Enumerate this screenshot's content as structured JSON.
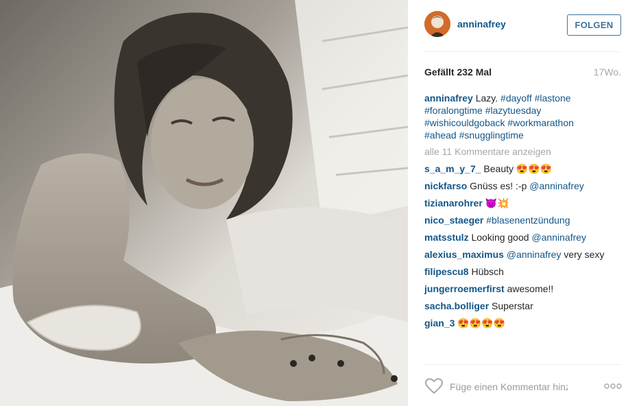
{
  "post": {
    "image_alt": "Schwarz-weiß Foto einer Frau im Bett",
    "author": "anninafrey",
    "follow_label": "FOLGEN",
    "likes": "Gefällt 232 Mal",
    "age": "17Wo.",
    "caption": {
      "user": "anninafrey",
      "text": "Lazy.",
      "tags": [
        "#dayoff",
        "#lastone",
        "#foralongtime",
        "#lazytuesday",
        "#wishicouldgoback",
        "#workmarathon",
        "#ahead",
        "#snugglingtime"
      ]
    },
    "more_comments": "alle 11 Kommentare anzeigen"
  },
  "comments": [
    {
      "user": "s_a_m_y_7_",
      "text": "Beauty 😍😍😍",
      "mention": ""
    },
    {
      "user": "nickfarso",
      "text": "Gnüss es! :-p",
      "mention": "@anninafrey"
    },
    {
      "user": "tizianarohrer",
      "text": "😈💥",
      "mention": ""
    },
    {
      "user": "nico_staeger",
      "text": "",
      "mention": "#blasenentzündung"
    },
    {
      "user": "matsstulz",
      "text": "Looking good",
      "mention": "@anninafrey"
    },
    {
      "user": "alexius_maximus",
      "text": "very sexy",
      "mention": "@anninafrey",
      "mention_first": true
    },
    {
      "user": "filipescu8",
      "text": "Hübsch",
      "mention": ""
    },
    {
      "user": "jungerroemerfirst",
      "text": "awesome!!",
      "mention": ""
    },
    {
      "user": "sacha.bolliger",
      "text": "Superstar",
      "mention": ""
    },
    {
      "user": "gian_3",
      "text": "😍😍😍😍",
      "mention": ""
    }
  ],
  "footer": {
    "comment_placeholder": "Füge einen Kommentar hinzu..."
  },
  "icons": {
    "like": "heart-icon",
    "options": "more-options-icon"
  },
  "colors": {
    "link": "#125688",
    "follow": "#3f729b",
    "muted": "#a5a7aa"
  }
}
